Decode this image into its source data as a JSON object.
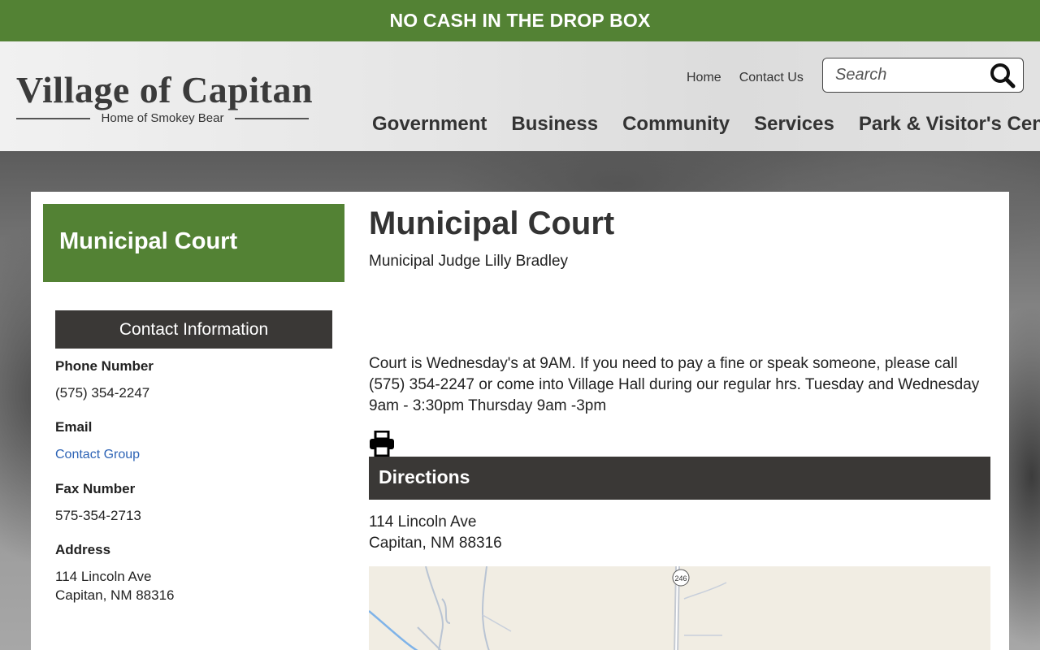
{
  "alert": {
    "text": "NO CASH IN THE DROP BOX"
  },
  "logo": {
    "title": "Village of Capitan",
    "subtitle": "Home of Smokey Bear"
  },
  "top_links": [
    {
      "label": "Home"
    },
    {
      "label": "Contact Us"
    }
  ],
  "search": {
    "placeholder": "Search",
    "icon": "search-icon"
  },
  "main_nav": [
    {
      "label": "Government"
    },
    {
      "label": "Business"
    },
    {
      "label": "Community"
    },
    {
      "label": "Services"
    },
    {
      "label": "Park & Visitor's Center"
    }
  ],
  "sidebar": {
    "title": "Municipal Court",
    "contact_heading": "Contact Information",
    "phone_label": "Phone Number",
    "phone": "(575) 354-2247",
    "email_label": "Email",
    "email_link": "Contact Group",
    "fax_label": "Fax Number",
    "fax": "575-354-2713",
    "address_label": "Address",
    "address_line1": "114 Lincoln Ave",
    "address_line2": "Capitan, NM 88316"
  },
  "main": {
    "title": "Municipal Court",
    "judge": "Municipal Judge Lilly Bradley",
    "description": "Court is Wednesday's at 9AM. If you need to pay a fine or speak someone, please call (575) 354-2247 or come into Village Hall during our regular hrs. Tuesday and Wednesday 9am - 3:30pm  Thursday 9am -3pm",
    "print_icon": "print-icon",
    "directions_heading": "Directions",
    "address_line1": "114 Lincoln Ave",
    "address_line2": "Capitan, NM 88316",
    "map": {
      "road_label": "246"
    }
  },
  "colors": {
    "brand_green": "#538234",
    "dark_header": "#3a3836",
    "link": "#2d63b5"
  }
}
